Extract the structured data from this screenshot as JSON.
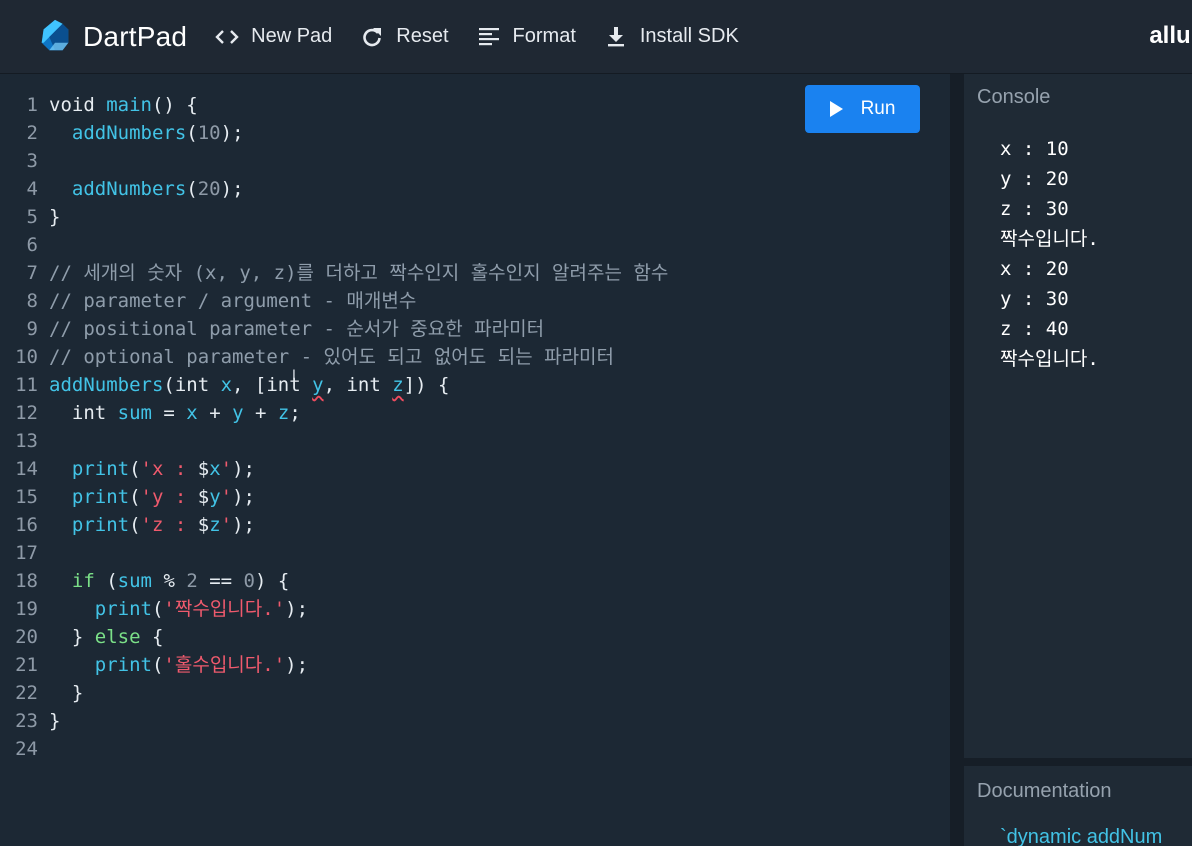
{
  "header": {
    "app_name": "DartPad",
    "new_pad": "New Pad",
    "reset": "Reset",
    "format": "Format",
    "install_sdk": "Install SDK",
    "user": "allur"
  },
  "editor": {
    "run_label": "Run",
    "lines": [
      {
        "n": "1",
        "t": "void main() {"
      },
      {
        "n": "2",
        "t": "  addNumbers(10);"
      },
      {
        "n": "3",
        "t": ""
      },
      {
        "n": "4",
        "t": "  addNumbers(20);"
      },
      {
        "n": "5",
        "t": "}"
      },
      {
        "n": "6",
        "t": ""
      },
      {
        "n": "7",
        "t": "// 세개의 숫자 (x, y, z)를 더하고 짝수인지 홀수인지 알려주는 함수"
      },
      {
        "n": "8",
        "t": "// parameter / argument - 매개변수"
      },
      {
        "n": "9",
        "t": "// positional parameter - 순서가 중요한 파라미터"
      },
      {
        "n": "10",
        "t": "// optional parameter - 있어도 되고 없어도 되는 파라미터"
      },
      {
        "n": "11",
        "t": "addNumbers(int x, [int y, int z]) {"
      },
      {
        "n": "12",
        "t": "  int sum = x + y + z;"
      },
      {
        "n": "13",
        "t": ""
      },
      {
        "n": "14",
        "t": "  print('x : $x');"
      },
      {
        "n": "15",
        "t": "  print('y : $y');"
      },
      {
        "n": "16",
        "t": "  print('z : $z');"
      },
      {
        "n": "17",
        "t": ""
      },
      {
        "n": "18",
        "t": "  if (sum % 2 == 0) {"
      },
      {
        "n": "19",
        "t": "    print('짝수입니다.');"
      },
      {
        "n": "20",
        "t": "  } else {"
      },
      {
        "n": "21",
        "t": "    print('홀수입니다.');"
      },
      {
        "n": "22",
        "t": "  }"
      },
      {
        "n": "23",
        "t": "}"
      },
      {
        "n": "24",
        "t": ""
      }
    ]
  },
  "console": {
    "title": "Console",
    "output": [
      "x : 10",
      "y : 20",
      "z : 30",
      "짝수입니다.",
      "x : 20",
      "y : 30",
      "z : 40",
      "짝수입니다."
    ]
  },
  "documentation": {
    "title": "Documentation",
    "text": "`dynamic addNum"
  },
  "colors": {
    "run_button": "#1a82f0",
    "function": "#42c3e6",
    "string": "#ef5a6d",
    "control": "#7be088"
  }
}
